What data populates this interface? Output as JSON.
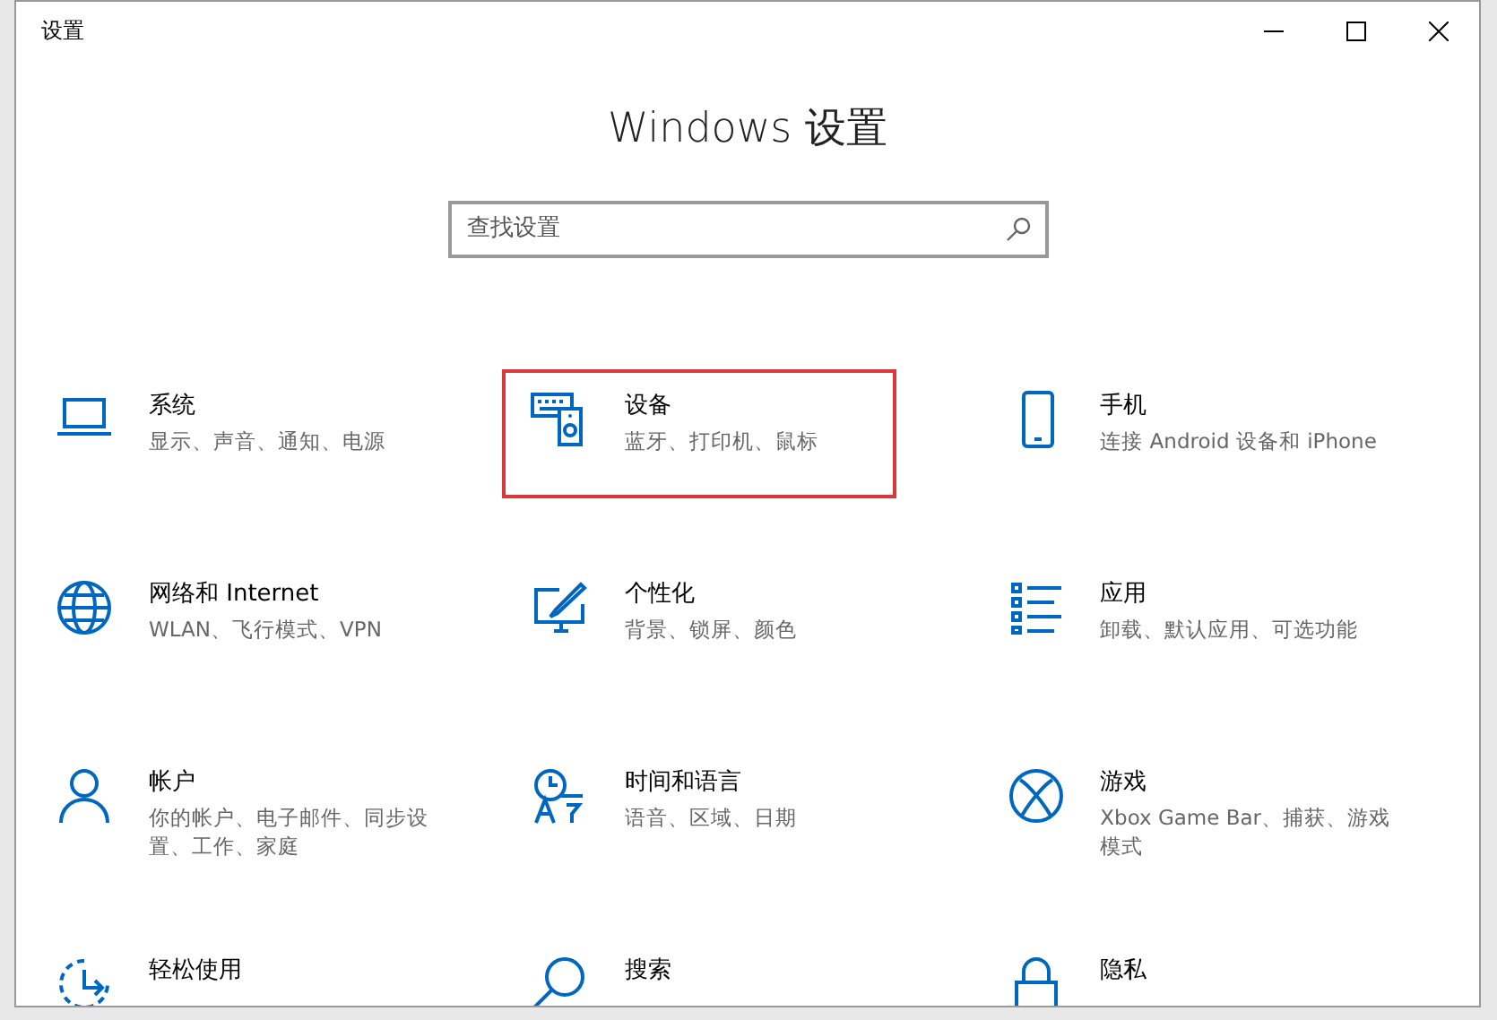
{
  "window": {
    "title": "设置"
  },
  "heading": "Windows 设置",
  "search": {
    "placeholder": "查找设置"
  },
  "items": [
    {
      "title": "系统",
      "description": "显示、声音、通知、电源",
      "highlighted": false
    },
    {
      "title": "设备",
      "description": "蓝牙、打印机、鼠标",
      "highlighted": true
    },
    {
      "title": "手机",
      "description": "连接 Android 设备和 iPhone",
      "highlighted": false
    },
    {
      "title": "网络和 Internet",
      "description": "WLAN、飞行模式、VPN",
      "highlighted": false
    },
    {
      "title": "个性化",
      "description": "背景、锁屏、颜色",
      "highlighted": false
    },
    {
      "title": "应用",
      "description": "卸载、默认应用、可选功能",
      "highlighted": false
    },
    {
      "title": "帐户",
      "description": "你的帐户、电子邮件、同步设置、工作、家庭",
      "highlighted": false
    },
    {
      "title": "时间和语言",
      "description": "语音、区域、日期",
      "highlighted": false
    },
    {
      "title": "游戏",
      "description": "Xbox Game Bar、捕获、游戏模式",
      "highlighted": false
    },
    {
      "title": "轻松使用",
      "highlighted": false
    },
    {
      "title": "搜索",
      "highlighted": false
    },
    {
      "title": "隐私",
      "highlighted": false
    }
  ]
}
